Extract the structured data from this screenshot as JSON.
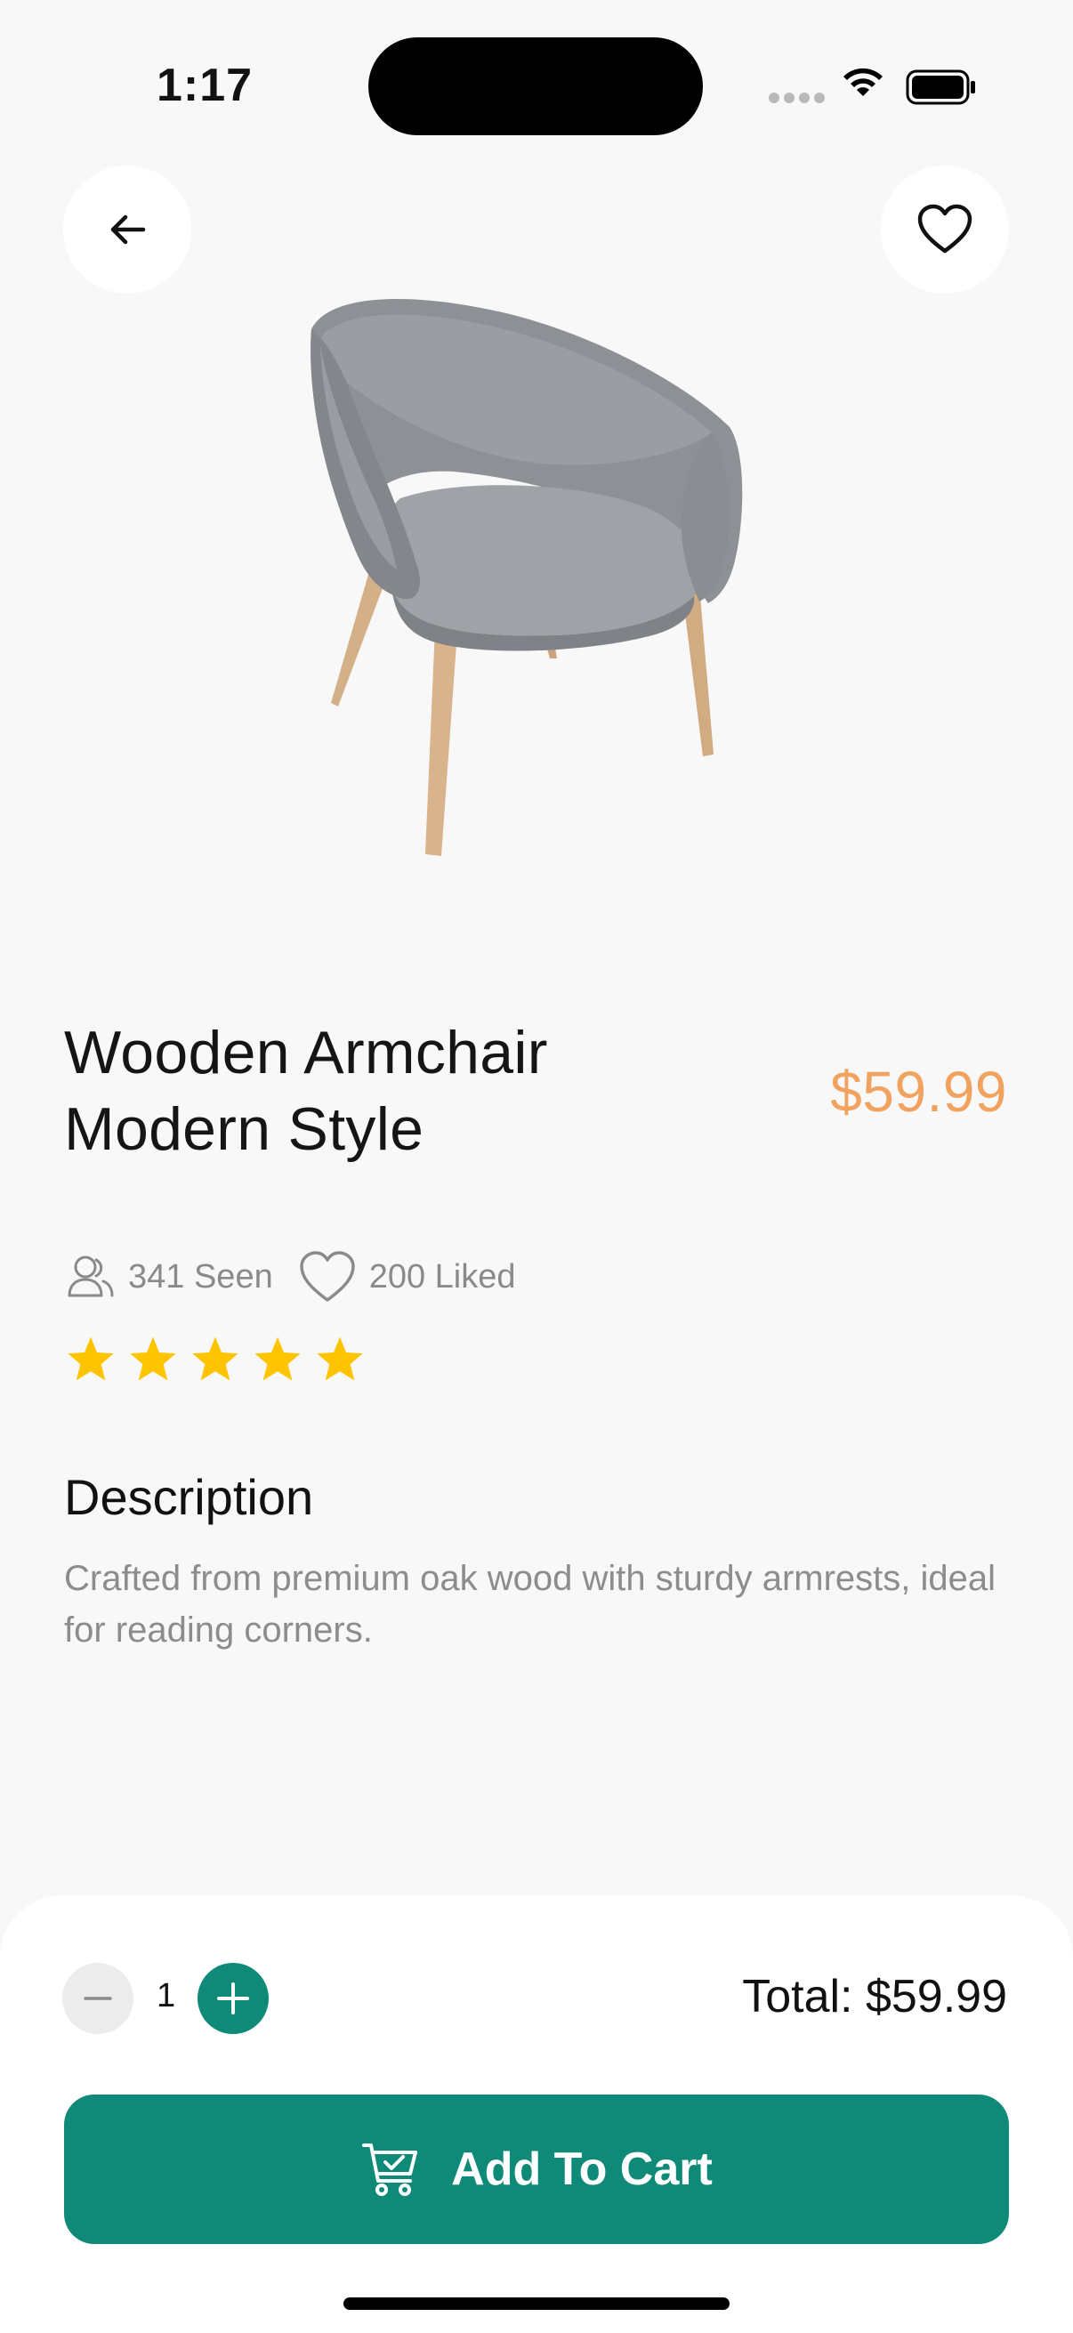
{
  "status_bar": {
    "time": "1:17"
  },
  "product": {
    "title": "Wooden Armchair\n Modern Style",
    "price": "$59.99",
    "seen": "341 Seen",
    "liked": "200 Liked",
    "rating": 5
  },
  "description": {
    "heading": "Description",
    "text": "Crafted from premium oak wood with sturdy armrests, ideal for reading corners."
  },
  "cart": {
    "quantity": "1",
    "total": "Total: $59.99",
    "button_label": "Add To Cart"
  },
  "colors": {
    "accent": "#0f8a78",
    "price": "#f0a25e",
    "star": "#ffc400",
    "background": "#f8f8f8"
  },
  "icons": [
    "arrow-left-icon",
    "heart-icon",
    "users-icon",
    "star-icon",
    "minus-icon",
    "plus-icon",
    "cart-check-icon"
  ]
}
